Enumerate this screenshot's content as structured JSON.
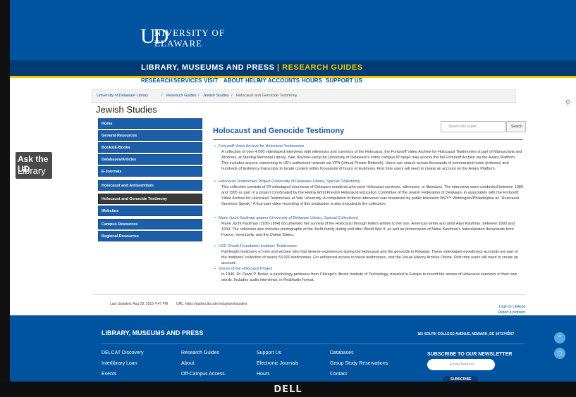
{
  "header": {
    "logo_ud": "UD",
    "logo_line1": "NIVERSITY OF",
    "logo_line2": "ELAWARE",
    "site_title": "LIBRARY, MUSEUMS AND PRESS",
    "site_subtitle": "RESEARCH GUIDES"
  },
  "nav": [
    "RESEARCH",
    "SERVICES",
    "VISIT",
    "ABOUT",
    "HELP",
    "MY ACCOUNTS",
    "HOURS",
    "SUPPORT US"
  ],
  "breadcrumb": {
    "c1": "University of Delaware Library",
    "c2": "Research Guides",
    "c3": "Jewish Studies",
    "c4": "Holocaust and Genocide Testimony"
  },
  "page_title": "Jewish Studies",
  "sidebar": {
    "items": [
      {
        "label": "Home"
      },
      {
        "label": "General Resources"
      },
      {
        "label": "Books/E-Books"
      },
      {
        "label": "Databases/Articles"
      },
      {
        "label": "E-Journals"
      },
      {
        "label": "Holocaust and Antisemitism"
      },
      {
        "label": "Holocaust and Genocide Testimony",
        "active": true
      },
      {
        "label": "Websites"
      },
      {
        "label": "Campus Resources"
      },
      {
        "label": "Regional Resources"
      }
    ]
  },
  "main": {
    "title": "Holocaust and Genocide Testimony",
    "search_placeholder": "Search this Guide",
    "search_button": "Search",
    "entries": [
      {
        "link": "Fortunoff Video Archive for Holocaust Testimonies",
        "desc": "A collection of over 4,000 videotaped interviews with witnesses and survivors of the Holocaust, the Fortunoff Video Archive for Holocaust Testimonies is part of Manuscripts and Archives, at Sterling Memorial Library, Yale. Anyone using the University of Delaware's entire campus IP range may access the full Fortunoff Archive via the Aviary Platform. This includes anyone connecting to UD's authorized network via VPN (Virtual Private Network). Users can search across thousands of summarized notes (indexes) and hundreds of testimony transcripts to locate content within thousands of hours of testimony. First time users will need to create an account on the Aviary Platform."
      },
      {
        "link": "Holocaust Testimonies Project (University of Delaware Library, Special Collections)",
        "desc": "This collection consists of 24 videotaped interviews of Delaware residents who were Holocaust survivors, witnesses, or liberators. The interviews were conducted between 1989 and 1995 as part of a project coordinated by the Halina Wind Preston Holocaust Education Committee of the Jewish Federation of Delaware, in association with the Fortunoff Video Archive for Holocaust Testimonies at Yale University. A compilation of these interviews was broadcast by public television WHYY Wilmington/Philadelphia as \"Holocaust Survivors Speak.\" A four-part video-recording of this production is also included in the collection."
      },
      {
        "link": "Marie Jucht Kaufman papers (University of Delaware Library, Special Collections)",
        "desc": "Marie Jucht Kaufman (1930-1994) documented her survival of the Holocaust through letters written to her son, American writer and artist Alan Kaufman, between 1993 and 1994. The collection also includes photographs of the Jucht family during and after World War II, as well as photocopies of Marie Kaufman's naturalization documents from France, Venezuela, and the United States."
      },
      {
        "link": "USC Shoah Foundation Institute: Testimonies",
        "desc": "Full-length testimony of men and women who had diverse experiences during the Holocaust and the genocide in Rwanda. These videotaped eyewitness accounts are part of the Institutes' collection of nearly 53,000 testimonies. For enhanced access to these testimonies, visit the Visual History Archive Online. First time users will need to create an account."
      },
      {
        "link": "Voices of the Holocaust Project",
        "desc": "In 1946, Dr. David P. Boder, a psychology professor from Chicago's Illinois Institute of Technology, traveled to Europe to record the stories of Holocaust survivors in their own words. Includes audio interviews, in RealAudio format."
      }
    ]
  },
  "ask": {
    "line1": "Ask the UD",
    "line2": "Library"
  },
  "meta": {
    "last_updated": "Last Updated: Aug 28, 2015 4:47 PM",
    "url": "URL: https://guides.lib.udel.edu/jewishstudies",
    "login": "Login to LibApps",
    "report": "Report a problem"
  },
  "footer": {
    "title": "LIBRARY, MUSEUMS AND PRESS",
    "address": "181 SOUTH COLLEGE AVENUE, NEWARK, DE 19717-5267",
    "col1": [
      "DELCAT Discovery",
      "Interlibrary Loan",
      "Events"
    ],
    "col2": [
      "Research Guides",
      "About",
      "Off-Campus Access"
    ],
    "col3": [
      "Support Us",
      "Electronic Journals",
      "Hours"
    ],
    "col4": [
      "Databases",
      "Group Study Reservations",
      "Contact"
    ],
    "newsletter_title": "SUBSCRIBE TO OUR NEWSLETTER",
    "email_placeholder": "Email Address",
    "subscribe": "SUBSCRIBE"
  },
  "monitor": {
    "brand": "DELL"
  },
  "colors": {
    "brand_blue": "#00539f",
    "accent_gold": "#f1c400",
    "active_sidebar": "#3a3a3a"
  }
}
